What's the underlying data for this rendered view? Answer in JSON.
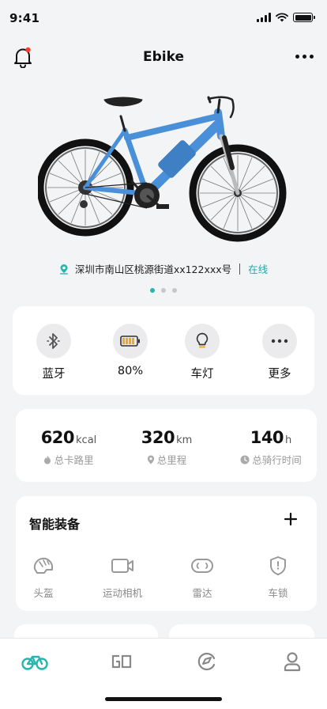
{
  "status_bar": {
    "time": "9:41"
  },
  "header": {
    "title": "Ebike"
  },
  "location": {
    "address": "深圳市南山区桃源街道xx122xxx号",
    "status": "在线"
  },
  "carousel": {
    "count": 3,
    "active_index": 0
  },
  "quick_actions": [
    {
      "label": "蓝牙",
      "icon": "bluetooth-icon"
    },
    {
      "label": "80%",
      "icon": "battery-icon"
    },
    {
      "label": "车灯",
      "icon": "lightbulb-icon"
    },
    {
      "label": "更多",
      "icon": "more-icon"
    }
  ],
  "stats": [
    {
      "value": "620",
      "unit": "kcal",
      "label": "总卡路里",
      "icon": "flame-icon"
    },
    {
      "value": "320",
      "unit": "km",
      "label": "总里程",
      "icon": "location-pin-icon"
    },
    {
      "value": "140",
      "unit": "h",
      "label": "总骑行时间",
      "icon": "clock-icon"
    }
  ],
  "devices": {
    "title": "智能装备",
    "items": [
      {
        "label": "头盔",
        "icon": "helmet-icon"
      },
      {
        "label": "运动相机",
        "icon": "camera-icon"
      },
      {
        "label": "雷达",
        "icon": "radar-icon"
      },
      {
        "label": "车锁",
        "icon": "lock-shield-icon"
      }
    ]
  },
  "colors": {
    "accent": "#27b5b0",
    "bike_frame": "#4a90d9",
    "battery_fill": "#f5a623",
    "background": "#f3f4f6"
  },
  "tabbar": [
    {
      "icon": "bike-icon",
      "active": true
    },
    {
      "icon": "go-icon",
      "active": false
    },
    {
      "icon": "discover-icon",
      "active": false
    },
    {
      "icon": "profile-icon",
      "active": false
    }
  ]
}
